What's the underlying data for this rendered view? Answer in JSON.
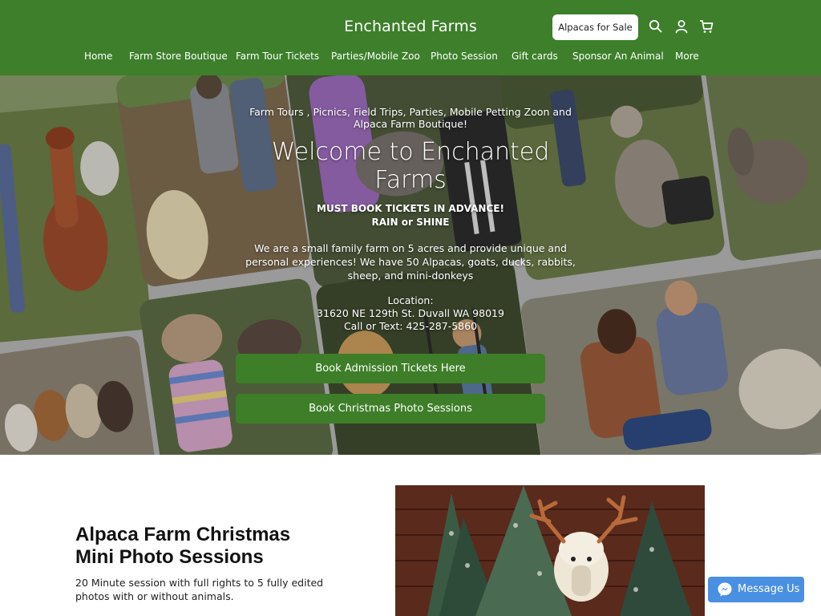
{
  "header": {
    "site_title": "Enchanted Farms",
    "cta_label": "Alpacas for Sale",
    "icons": [
      "search-icon",
      "account-icon",
      "cart-icon"
    ],
    "nav": [
      "Home",
      "Farm Store Boutique",
      "Farm Tour Tickets",
      "Parties/Mobile Zoo",
      "Photo Session",
      "Gift cards",
      "Sponsor An Animal",
      "More"
    ]
  },
  "hero": {
    "tagline_1": "Farm Tours , Picnics, Field Trips, Parties, Mobile Petting Zoon and",
    "tagline_2": "Alpaca Farm Boutique!",
    "heading_1": "Welcome to Enchanted",
    "heading_2": "Farms",
    "notice_1": "MUST BOOK TICKETS IN ADVANCE!",
    "notice_2": "RAIN or SHINE",
    "intro_1": "We are a small family farm on 5 acres and provide unique and",
    "intro_2": "personal experiences! We have 50 Alpacas, goats, ducks, rabbits,",
    "intro_3": "sheep, and mini-donkeys",
    "location_label": "Location:",
    "address": "31620 NE 129th St. Duvall WA 98019",
    "contact": "Call or Text: 425-287-5860",
    "btn_tickets": "Book Admission Tickets Here",
    "btn_christmas": "Book Christmas Photo Sessions"
  },
  "section": {
    "title_1": "Alpaca Farm Christmas",
    "title_2": "Mini Photo Sessions",
    "desc_1": "20 Minute session with full rights to 5 fully edited",
    "desc_2": "photos with or without animals."
  },
  "messenger": {
    "label": "Message Us",
    "icon": "messenger-icon"
  },
  "colors": {
    "brand_green": "#3d7f2a",
    "button_green": "#3e7e28",
    "messenger_blue": "#4a90e2"
  }
}
